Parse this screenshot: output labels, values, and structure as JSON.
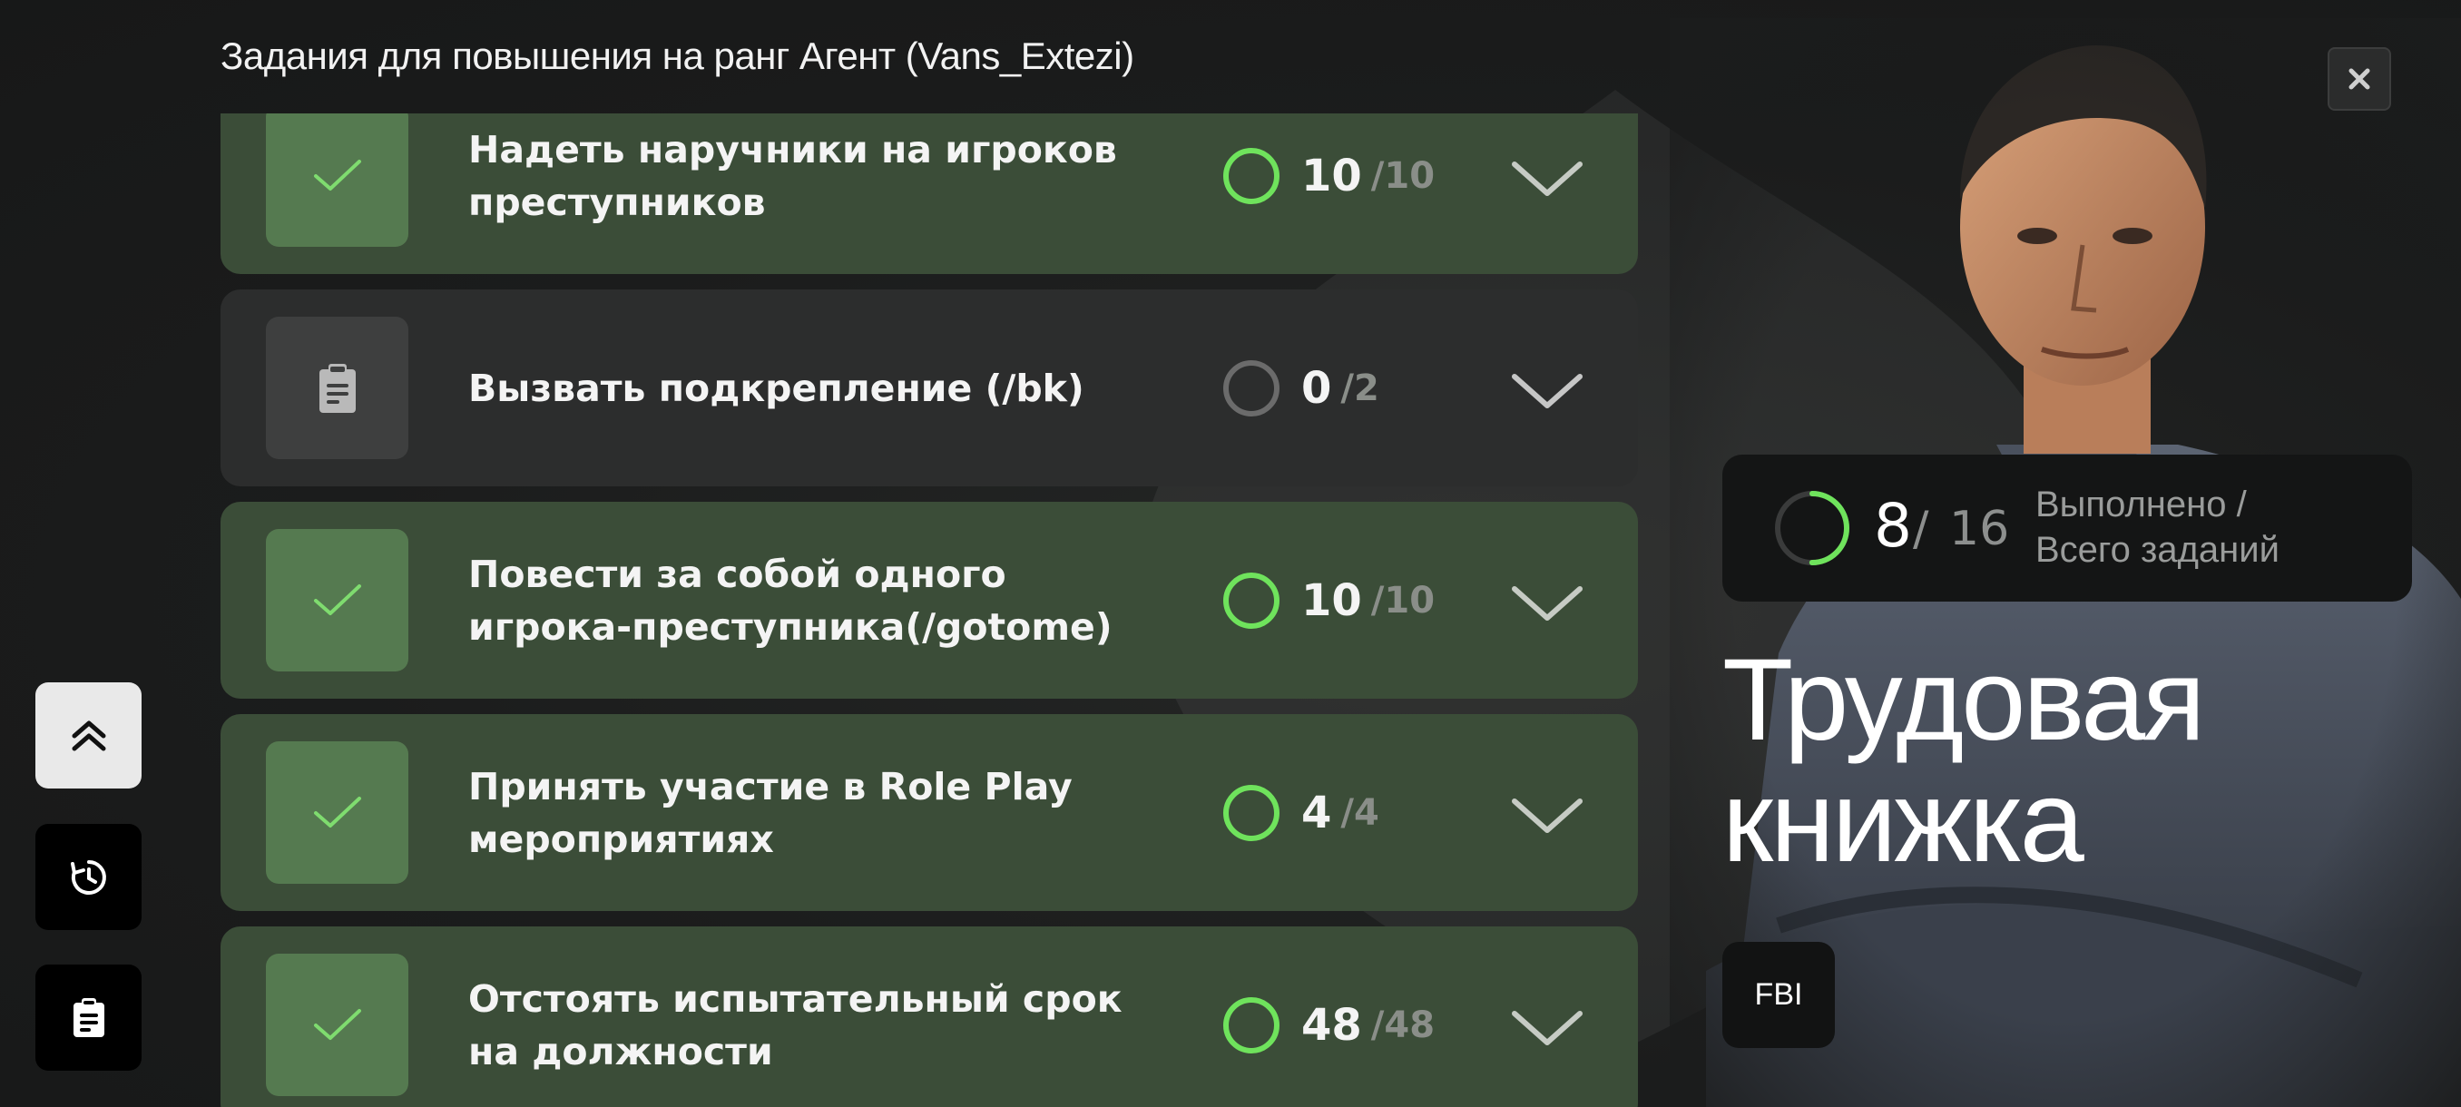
{
  "header": {
    "title": "Задания для повышения на ранг  Агент (Vans_Extezi)"
  },
  "tasks": [
    {
      "title": "Надеть наручники на игроков преступников",
      "current": "10",
      "total": "10",
      "completed": true,
      "icon": "check-icon"
    },
    {
      "title": "Вызвать подкрепление (/bk)",
      "current": "0",
      "total": "2",
      "completed": false,
      "icon": "clipboard-icon"
    },
    {
      "title": "Повести за собой одного игрока-преступника(/gotome)",
      "current": "10",
      "total": "10",
      "completed": true,
      "icon": "check-icon"
    },
    {
      "title": "Принять участие в Role Play мероприятиях",
      "current": "4",
      "total": "4",
      "completed": true,
      "icon": "check-icon"
    },
    {
      "title": "Отстоять испытательный срок на должности",
      "current": "48",
      "total": "48",
      "completed": true,
      "icon": "check-icon"
    }
  ],
  "progress_separator": "/",
  "stats": {
    "done": "8",
    "separator": "/",
    "total": "16",
    "label": "Выполнено / Всего заданий",
    "fraction_done": 0.5
  },
  "book_title": "Трудовая книжка",
  "organization": "FBI",
  "colors": {
    "completed_card": "#3b4d38",
    "incomplete_card": "#2c2d2d",
    "progress_ring_complete": "#6fe35c",
    "accent_green": "#6fe35c"
  }
}
